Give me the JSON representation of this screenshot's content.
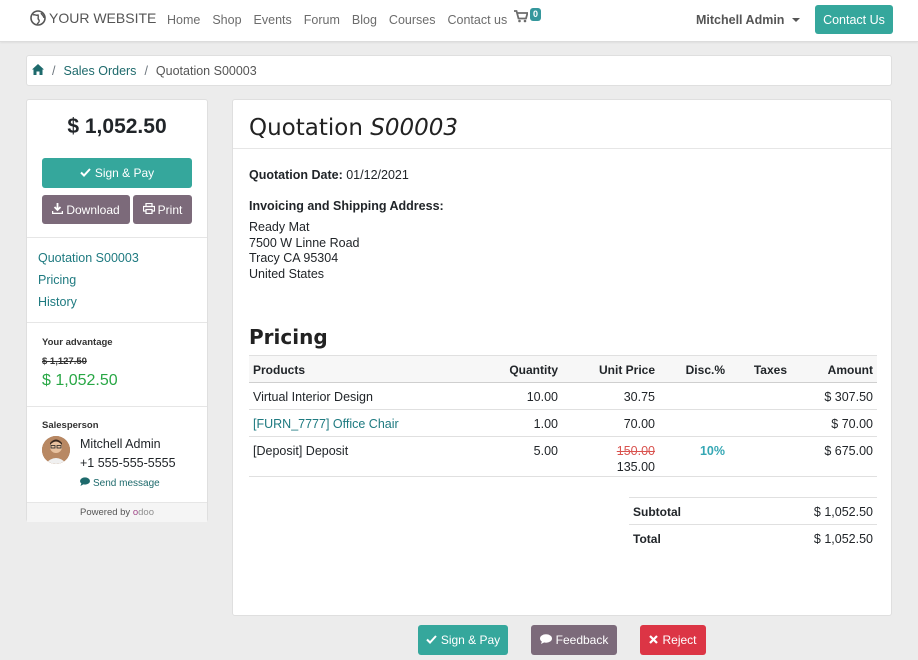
{
  "navbar": {
    "brand": "YOUR WEBSITE",
    "menu": [
      "Home",
      "Shop",
      "Events",
      "Forum",
      "Blog",
      "Courses",
      "Contact us"
    ],
    "cart_count": "0",
    "user": "Mitchell Admin",
    "contact_button": "Contact Us"
  },
  "breadcrumb": {
    "items": [
      "Sales Orders",
      "Quotation S00003"
    ]
  },
  "sidebar": {
    "amount": "$ 1,052.50",
    "sign_pay": "Sign & Pay",
    "download": "Download",
    "print": "Print",
    "nav": [
      "Quotation S00003",
      "Pricing",
      "History"
    ],
    "advantage_label": "Your advantage",
    "old_price": "$ 1,127.50",
    "new_price": "$ 1,052.50",
    "salesperson_label": "Salesperson",
    "salesperson_name": "Mitchell Admin",
    "salesperson_phone": "+1 555-555-5555",
    "send_message": "Send message",
    "powered_by": "Powered by",
    "powered_brand_o": "o",
    "powered_brand_rest": "doo"
  },
  "main": {
    "title_prefix": "Quotation",
    "title_number": "S00003",
    "date_label": "Quotation Date:",
    "date_value": "01/12/2021",
    "address_label": "Invoicing and Shipping Address:",
    "address_lines": [
      "Ready Mat",
      "7500 W Linne Road",
      "Tracy CA 95304",
      "United States"
    ],
    "pricing_title": "Pricing",
    "table": {
      "headers": {
        "products": "Products",
        "quantity": "Quantity",
        "unit_price": "Unit Price",
        "disc": "Disc.%",
        "taxes": "Taxes",
        "amount": "Amount"
      },
      "rows": [
        {
          "product": "Virtual Interior Design",
          "quantity": "10.00",
          "unit_price": "30.75",
          "disc": "",
          "amount": "$ 307.50"
        },
        {
          "product": "[FURN_7777] Office Chair",
          "quantity": "1.00",
          "unit_price": "70.00",
          "disc": "",
          "amount": "$ 70.00"
        },
        {
          "product": "[Deposit] Deposit",
          "quantity": "5.00",
          "old_unit_price": "150.00",
          "unit_price": "135.00",
          "disc": "10%",
          "amount": "$ 675.00"
        }
      ]
    },
    "subtotal_label": "Subtotal",
    "subtotal_value": "$ 1,052.50",
    "total_label": "Total",
    "total_value": "$ 1,052.50"
  },
  "bottom_buttons": {
    "sign_pay": "Sign & Pay",
    "feedback": "Feedback",
    "reject": "Reject"
  },
  "colors": {
    "primary": "#35a79c",
    "secondary": "#7c6a7a",
    "danger": "#dc3545",
    "success": "#28a745",
    "link": "#1e7a80"
  }
}
